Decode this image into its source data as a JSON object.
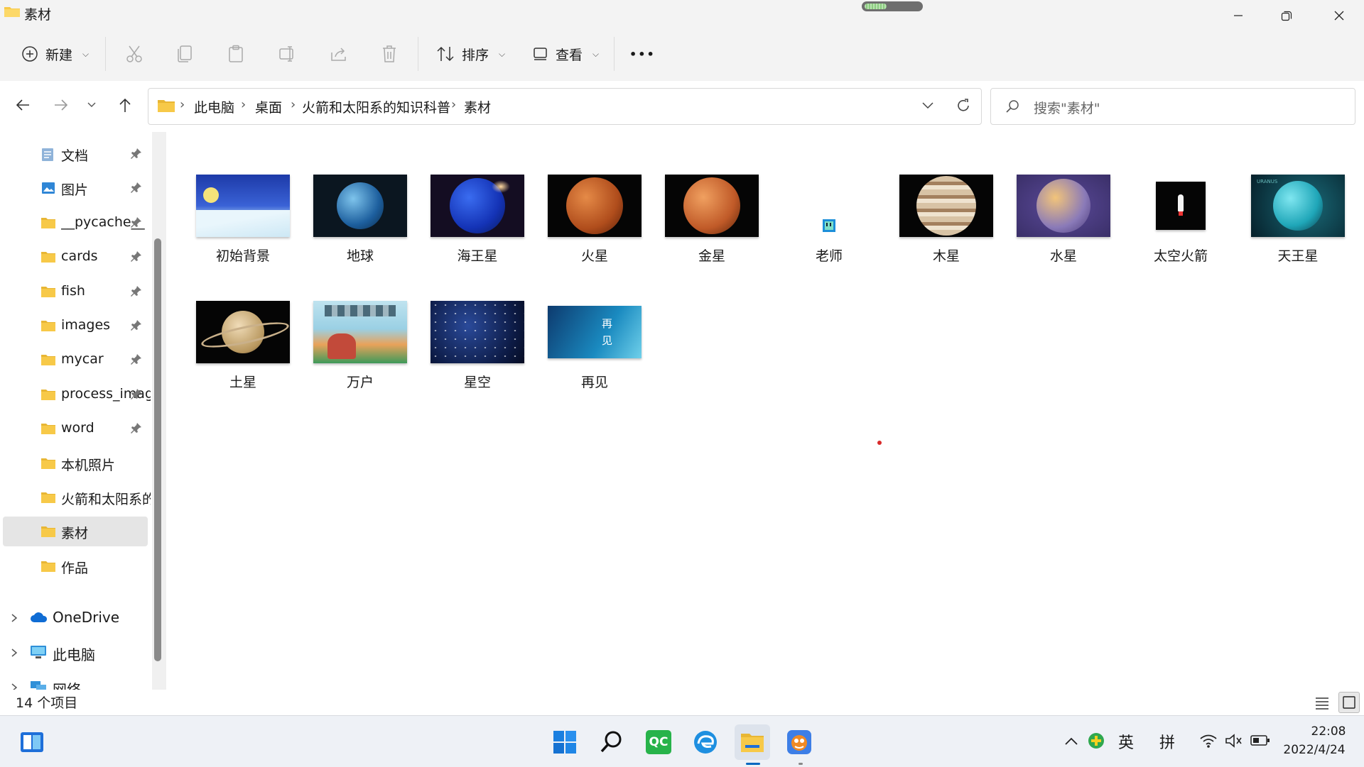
{
  "window": {
    "title": "素材",
    "loading_progress": 0.4
  },
  "toolbar": {
    "new_label": "新建",
    "sort_label": "排序",
    "view_label": "查看",
    "more_label": "•••"
  },
  "breadcrumb": [
    "此电脑",
    "桌面",
    "火箭和太阳系的知识科普",
    "素材"
  ],
  "search": {
    "placeholder": "搜索\"素材\""
  },
  "sidebar": {
    "items": [
      {
        "label": "文档",
        "icon": "document-icon",
        "pinned": true
      },
      {
        "label": "图片",
        "icon": "pictures-icon",
        "pinned": true
      },
      {
        "label": "__pycache__",
        "icon": "folder-icon",
        "pinned": true
      },
      {
        "label": "cards",
        "icon": "folder-icon",
        "pinned": true
      },
      {
        "label": "fish",
        "icon": "folder-icon",
        "pinned": true
      },
      {
        "label": "images",
        "icon": "folder-icon",
        "pinned": true
      },
      {
        "label": "mycar",
        "icon": "folder-icon",
        "pinned": true
      },
      {
        "label": "process_images",
        "icon": "folder-icon",
        "pinned": true
      },
      {
        "label": "word",
        "icon": "folder-icon",
        "pinned": true
      },
      {
        "label": "本机照片",
        "icon": "folder-icon",
        "pinned": false
      },
      {
        "label": "火箭和太阳系的知识科普",
        "icon": "folder-icon",
        "pinned": false
      },
      {
        "label": "素材",
        "icon": "folder-icon",
        "pinned": false,
        "selected": true
      },
      {
        "label": "作品",
        "icon": "folder-icon",
        "pinned": false
      }
    ],
    "tree": [
      {
        "label": "OneDrive",
        "icon": "cloud-icon"
      },
      {
        "label": "此电脑",
        "icon": "computer-icon"
      },
      {
        "label": "网络",
        "icon": "network-icon"
      }
    ]
  },
  "files": [
    {
      "name": "初始背景",
      "thumb": "snow-scene"
    },
    {
      "name": "地球",
      "thumb": "earth"
    },
    {
      "name": "海王星",
      "thumb": "neptune"
    },
    {
      "name": "火星",
      "thumb": "mars"
    },
    {
      "name": "金星",
      "thumb": "venus"
    },
    {
      "name": "老师",
      "thumb": "teacher-icon"
    },
    {
      "name": "木星",
      "thumb": "jupiter"
    },
    {
      "name": "水星",
      "thumb": "mercury"
    },
    {
      "name": "太空火箭",
      "thumb": "rocket"
    },
    {
      "name": "天王星",
      "thumb": "uranus"
    },
    {
      "name": "土星",
      "thumb": "saturn"
    },
    {
      "name": "万户",
      "thumb": "wanhu-painting"
    },
    {
      "name": "星空",
      "thumb": "starry-sky"
    },
    {
      "name": "再见",
      "thumb": "goodbye"
    }
  ],
  "thumb_text": {
    "uranus": "URANUS",
    "goodbye_1": "再",
    "goodbye_2": "见"
  },
  "status": {
    "item_count": "14 个项目"
  },
  "taskbar": {
    "apps": [
      "windows-start-icon",
      "search-icon",
      "qc-app-icon",
      "edge-browser-icon",
      "file-explorer-icon",
      "scratch-app-icon"
    ],
    "qc_label": "QC",
    "ime_lang": "英",
    "ime_mode": "拼",
    "time": "22:08",
    "date": "2022/4/24"
  },
  "colors": {
    "folder": "#f7c948",
    "accent": "#0067c0",
    "selection": "#e5e5e5"
  }
}
